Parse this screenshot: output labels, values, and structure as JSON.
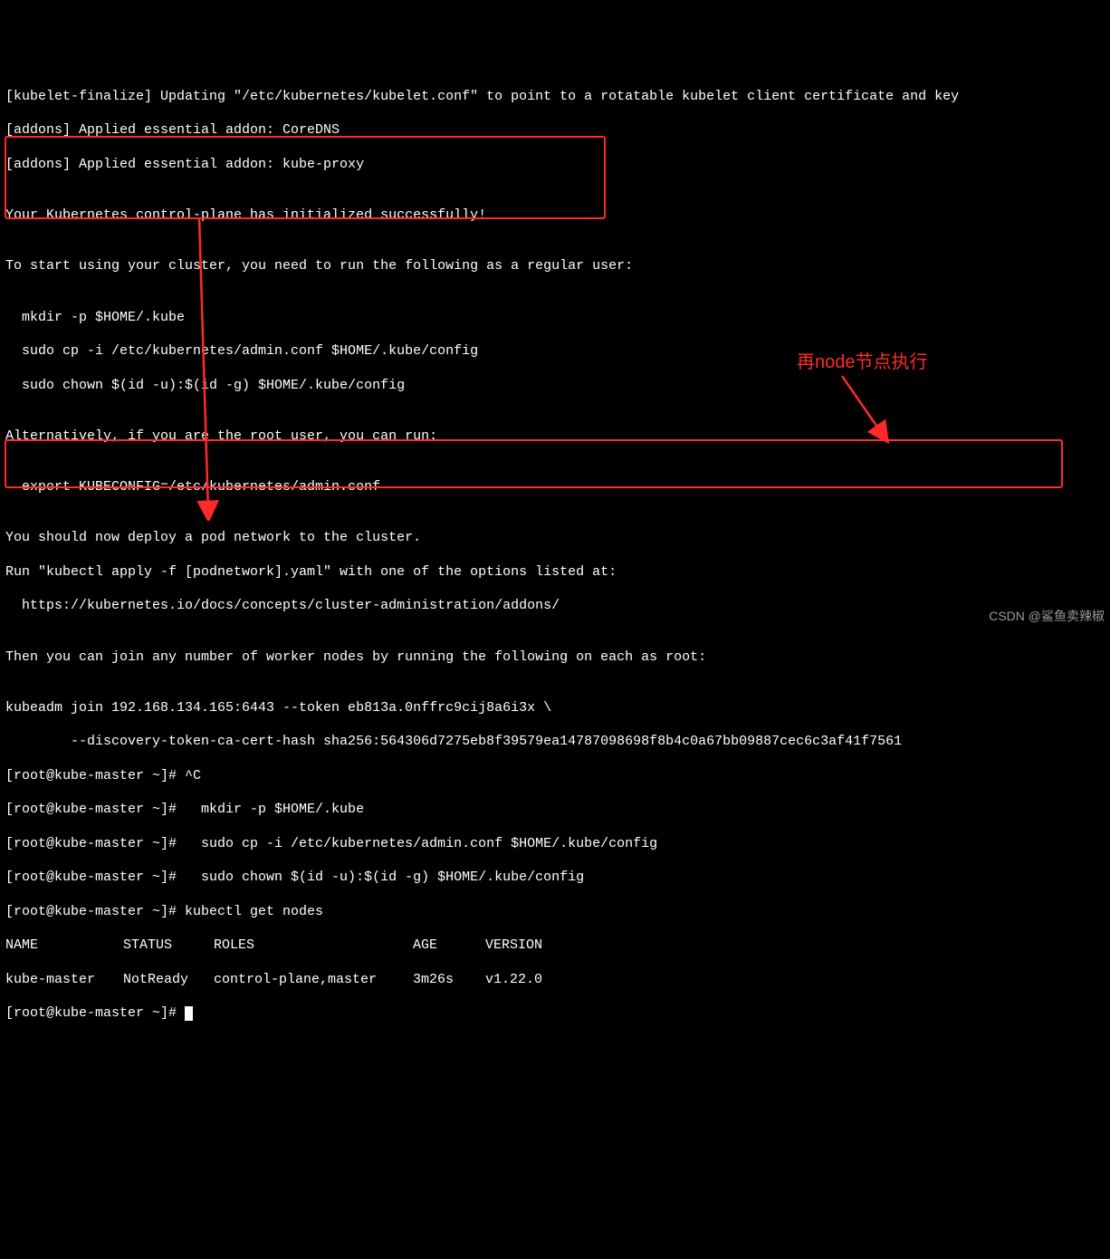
{
  "lines": {
    "l0": "[kubelet-finalize] Updating \"/etc/kubernetes/kubelet.conf\" to point to a rotatable kubelet client certificate and key",
    "l1": "[addons] Applied essential addon: CoreDNS",
    "l2": "[addons] Applied essential addon: kube-proxy",
    "l3": "",
    "l4": "Your Kubernetes control-plane has initialized successfully!",
    "l5": "",
    "l6": "To start using your cluster, you need to run the following as a regular user:",
    "l7": "",
    "l8": "  mkdir -p $HOME/.kube",
    "l9": "  sudo cp -i /etc/kubernetes/admin.conf $HOME/.kube/config",
    "l10": "  sudo chown $(id -u):$(id -g) $HOME/.kube/config",
    "l11": "",
    "l12": "Alternatively, if you are the root user, you can run:",
    "l13": "",
    "l14": "  export KUBECONFIG=/etc/kubernetes/admin.conf",
    "l15": "",
    "l16": "You should now deploy a pod network to the cluster.",
    "l17": "Run \"kubectl apply -f [podnetwork].yaml\" with one of the options listed at:",
    "l18": "  https://kubernetes.io/docs/concepts/cluster-administration/addons/",
    "l19": "",
    "l20": "Then you can join any number of worker nodes by running the following on each as root:",
    "l21": "",
    "l22": "kubeadm join 192.168.134.165:6443 --token eb813a.0nffrc9cij8a6i3x \\",
    "l23": "        --discovery-token-ca-cert-hash sha256:564306d7275eb8f39579ea14787098698f8b4c0a67bb09887cec6c3af41f7561",
    "l24": "[root@kube-master ~]# ^C",
    "l25": "[root@kube-master ~]#   mkdir -p $HOME/.kube",
    "l26": "[root@kube-master ~]#   sudo cp -i /etc/kubernetes/admin.conf $HOME/.kube/config",
    "l27": "[root@kube-master ~]#   sudo chown $(id -u):$(id -g) $HOME/.kube/config",
    "l28": "[root@kube-master ~]# kubectl get nodes",
    "l31": "[root@kube-master ~]# "
  },
  "table": {
    "header": {
      "c0": "NAME",
      "c1": "STATUS",
      "c2": "ROLES",
      "c3": "AGE",
      "c4": "VERSION"
    },
    "row": {
      "c0": "kube-master",
      "c1": "NotReady",
      "c2": "control-plane,master",
      "c3": "3m26s",
      "c4": "v1.22.0"
    }
  },
  "annotation": "再node节点执行",
  "watermark": "CSDN @鲨鱼卖辣椒"
}
